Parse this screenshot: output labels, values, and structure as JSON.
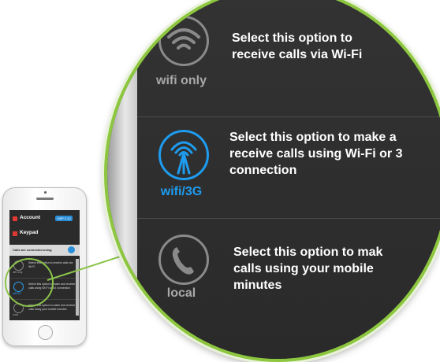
{
  "phone_screen": {
    "account_label": "Account",
    "account_badge": "GBP 2.10",
    "keypad_label": "Keypad",
    "connection_text": "Calls are connected using",
    "options": [
      {
        "caption": "wifi only",
        "text": "Select this option to receive calls via Wi-Fi"
      },
      {
        "caption": "wifi/3G",
        "text": "Select this option to make and receive calls using Wi-Fi or 3G connection"
      },
      {
        "caption": "local",
        "text": "Select this option to make and receive calls using your mobile minutes"
      }
    ]
  },
  "magnified": {
    "options": [
      {
        "caption": "wifi only",
        "text": "Select this option to\nreceive calls via Wi-Fi",
        "icon": "wifi-icon",
        "color": "#8a8a8a"
      },
      {
        "caption": "wifi/3G",
        "text": "Select this option to make a\nreceive calls using Wi-Fi or 3\nconnection",
        "icon": "cell-tower-icon",
        "color": "#1e9cf0"
      },
      {
        "caption": "local",
        "text": "Select this option to mak\ncalls using your mobile\nminutes",
        "icon": "phone-handset-icon",
        "color": "#8a8a8a"
      }
    ]
  },
  "colors": {
    "ring_accent": "#8dc63f",
    "selected_blue": "#1e9cf0",
    "panel_bg": "#2c2c2c"
  }
}
